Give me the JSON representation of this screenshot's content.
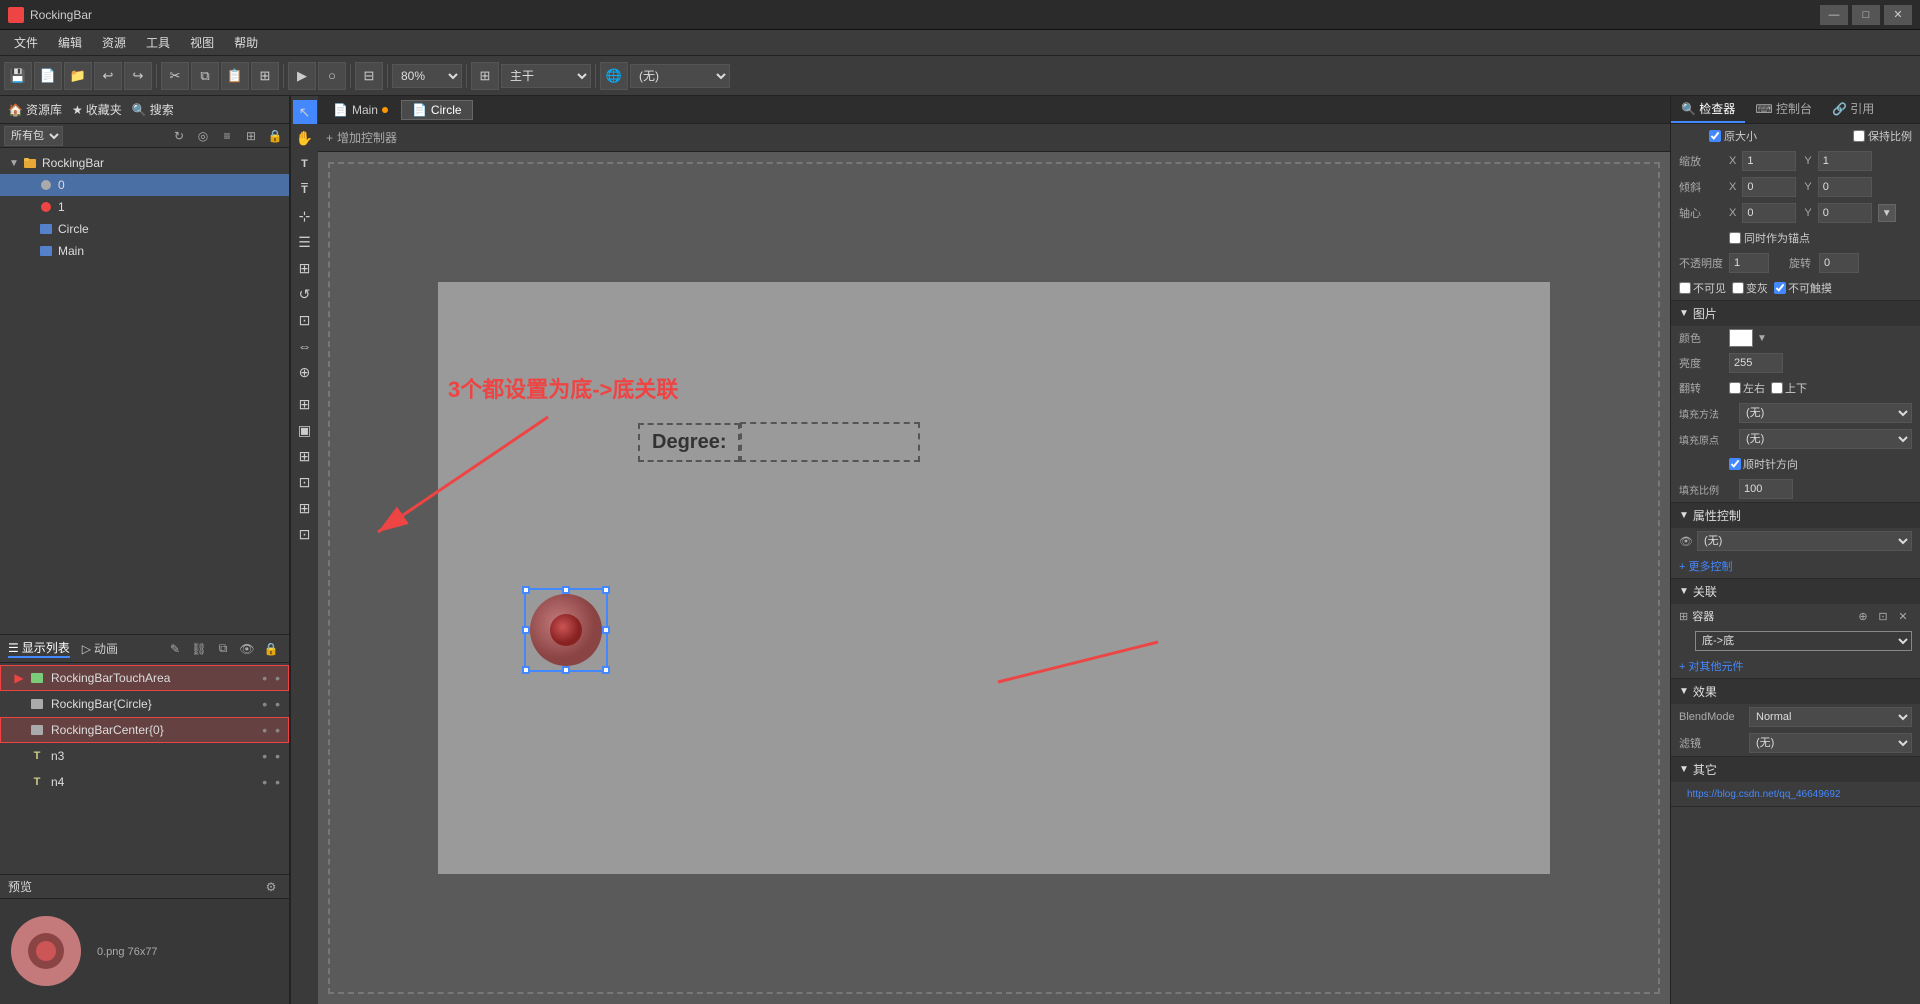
{
  "app": {
    "title": "RockingBar",
    "window_controls": [
      "—",
      "□",
      "✕"
    ]
  },
  "menubar": {
    "items": [
      "文件",
      "编辑",
      "资源",
      "工具",
      "视图",
      "帮助"
    ]
  },
  "toolbar": {
    "zoom_value": "80%",
    "mode_value": "主干",
    "network_value": "(无)"
  },
  "left_panel": {
    "resource_header_items": [
      "资源库",
      "收藏夹",
      "搜索"
    ],
    "filter_value": "所有包",
    "tree_items": [
      {
        "id": "rockingbar",
        "label": "RockingBar",
        "level": 0,
        "type": "root",
        "expanded": true
      },
      {
        "id": "0",
        "label": "0",
        "level": 1,
        "type": "node",
        "selected": true
      },
      {
        "id": "1",
        "label": "1",
        "level": 1,
        "type": "node_red"
      },
      {
        "id": "circle",
        "label": "Circle",
        "level": 1,
        "type": "scene"
      },
      {
        "id": "main",
        "label": "Main",
        "level": 1,
        "type": "scene"
      }
    ]
  },
  "scene_tabs": [
    {
      "label": "Main",
      "has_dot": true,
      "active": false
    },
    {
      "label": "Circle",
      "has_dot": false,
      "active": true
    }
  ],
  "canvas": {
    "add_controller_label": "增加控制器",
    "annotation_text": "3个都设置为底->底关联",
    "degree_label": "Degree:",
    "scene_bg": "#8a8a8a"
  },
  "layer_panel": {
    "tabs": [
      "显示列表",
      "动画"
    ],
    "items": [
      {
        "label": "RockingBarTouchArea",
        "type": "node",
        "selected": true
      },
      {
        "label": "RockingBar{Circle}",
        "type": "node",
        "selected": false
      },
      {
        "label": "RockingBarCenter{0}",
        "type": "node",
        "selected": false,
        "highlighted": true
      },
      {
        "label": "n3",
        "type": "text"
      },
      {
        "label": "n4",
        "type": "text"
      }
    ]
  },
  "preview_panel": {
    "label": "预览",
    "info": "0.png  76x77",
    "settings_icon": "⚙"
  },
  "right_panel": {
    "tabs": [
      "检查器",
      "控制台",
      "引用"
    ],
    "sections": {
      "transform": {
        "scale": {
          "x": "1",
          "y": "1"
        },
        "skew": {
          "x": "0",
          "y": "0"
        },
        "pivot": {
          "x": "0",
          "y": "0"
        },
        "keep_ratio": "保持比例",
        "same_as_pivot": "同时作为锚点",
        "opacity": "1",
        "rotation": "0",
        "invisible": "不可见",
        "grey": "变灰",
        "no_touch": "不可触摸",
        "scale_label": "缩放",
        "skew_label": "倾斜",
        "pivot_label": "轴心"
      },
      "image": {
        "label": "图片",
        "color_label": "颜色",
        "brightness_label": "亮度",
        "brightness_value": "255",
        "flip_label": "翻转",
        "flip_h": "左右",
        "flip_v": "上下",
        "fill_method_label": "填充方法",
        "fill_method_value": "(无)",
        "fill_origin_label": "填充原点",
        "fill_origin_value": "(无)",
        "clockwise": "顺时针方向",
        "fill_ratio_label": "填充比例",
        "fill_ratio_value": "100"
      },
      "property_control": {
        "label": "属性控制",
        "value": "(无)",
        "add_more": "+ 更多控制"
      },
      "links": {
        "label": "关联",
        "container_label": "容器",
        "container_value": "底->底",
        "add_other": "+ 对其他元件"
      },
      "effects": {
        "label": "效果",
        "blend_mode_label": "BlendMode",
        "blend_mode_value": "Normal",
        "filter_label": "滤镜",
        "filter_value": "(无)"
      },
      "other": {
        "label": "其它",
        "url": "https://blog.csdn.net/qq_46649692"
      }
    }
  },
  "status_bar": {
    "info": "0.png  76x77"
  }
}
